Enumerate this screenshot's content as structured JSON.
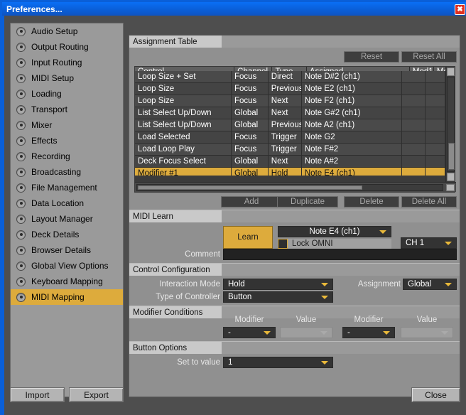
{
  "window": {
    "title": "Preferences...",
    "close_icon": "close-icon",
    "close_glyph": "✖"
  },
  "sidebar": {
    "items": [
      {
        "label": "Audio Setup",
        "selected": false
      },
      {
        "label": "Output Routing",
        "selected": false
      },
      {
        "label": "Input Routing",
        "selected": false
      },
      {
        "label": "MIDI Setup",
        "selected": false
      },
      {
        "label": "Loading",
        "selected": false
      },
      {
        "label": "Transport",
        "selected": false
      },
      {
        "label": "Mixer",
        "selected": false
      },
      {
        "label": "Effects",
        "selected": false
      },
      {
        "label": "Recording",
        "selected": false
      },
      {
        "label": "Broadcasting",
        "selected": false
      },
      {
        "label": "File Management",
        "selected": false
      },
      {
        "label": "Data Location",
        "selected": false
      },
      {
        "label": "Layout Manager",
        "selected": false
      },
      {
        "label": "Deck Details",
        "selected": false
      },
      {
        "label": "Browser Details",
        "selected": false
      },
      {
        "label": "Global View Options",
        "selected": false
      },
      {
        "label": "Keyboard Mapping",
        "selected": false
      },
      {
        "label": "MIDI Mapping",
        "selected": true
      }
    ]
  },
  "assignment_table": {
    "section_title": "Assignment Table",
    "reset_label": "Reset",
    "reset_all_label": "Reset All",
    "columns": [
      "Control",
      "Channel",
      "Type",
      "Assigned",
      "Mod1",
      "Mo"
    ],
    "rows": [
      {
        "control": "Loop Size + Set",
        "channel": "Focus",
        "type": "Direct",
        "assigned": "Note D#2 (ch1)",
        "mod1": "",
        "mod2": "",
        "selected": false
      },
      {
        "control": "Loop Size",
        "channel": "Focus",
        "type": "Previous",
        "assigned": "Note E2 (ch1)",
        "mod1": "",
        "mod2": "",
        "selected": false
      },
      {
        "control": "Loop Size",
        "channel": "Focus",
        "type": "Next",
        "assigned": "Note F2 (ch1)",
        "mod1": "",
        "mod2": "",
        "selected": false
      },
      {
        "control": "List Select Up/Down",
        "channel": "Global",
        "type": "Next",
        "assigned": "Note G#2 (ch1)",
        "mod1": "",
        "mod2": "",
        "selected": false
      },
      {
        "control": "List Select Up/Down",
        "channel": "Global",
        "type": "Previous",
        "assigned": "Note A2 (ch1)",
        "mod1": "",
        "mod2": "",
        "selected": false
      },
      {
        "control": "Load Selected",
        "channel": "Focus",
        "type": "Trigger",
        "assigned": "Note G2",
        "mod1": "",
        "mod2": "",
        "selected": false
      },
      {
        "control": "Load Loop Play",
        "channel": "Focus",
        "type": "Trigger",
        "assigned": "Note F#2",
        "mod1": "",
        "mod2": "",
        "selected": false
      },
      {
        "control": "Deck Focus Select",
        "channel": "Global",
        "type": "Next",
        "assigned": "Note A#2",
        "mod1": "",
        "mod2": "",
        "selected": false
      },
      {
        "control": "Modifier #1",
        "channel": "Global",
        "type": "Hold",
        "assigned": "Note E4 (ch1)",
        "mod1": "",
        "mod2": "",
        "selected": true
      }
    ],
    "add_label": "Add",
    "duplicate_label": "Duplicate",
    "delete_label": "Delete",
    "delete_all_label": "Delete All"
  },
  "midi_learn": {
    "section_title": "MIDI Learn",
    "learn_label": "Learn",
    "note_value": "Note E4 (ch1)",
    "lock_omni_label": "Lock OMNI",
    "lock_omni_checked": false,
    "channel_value": "CH 1",
    "comment_label": "Comment",
    "comment_value": "",
    "comment_placeholder": ""
  },
  "control_configuration": {
    "section_title": "Control Configuration",
    "interaction_mode_label": "Interaction Mode",
    "interaction_mode_value": "Hold",
    "type_of_controller_label": "Type of Controller",
    "type_of_controller_value": "Button",
    "assignment_label": "Assignment",
    "assignment_value": "Global"
  },
  "modifier_conditions": {
    "section_title": "Modifier Conditions",
    "modifier_label_1": "Modifier",
    "value_label_1": "Value",
    "modifier_label_2": "Modifier",
    "value_label_2": "Value",
    "modifier_value_1": "-",
    "cond_value_1": "",
    "modifier_value_2": "-",
    "cond_value_2": ""
  },
  "button_options": {
    "section_title": "Button Options",
    "set_to_value_label": "Set to value",
    "set_to_value": "1"
  },
  "footer": {
    "import_label": "Import",
    "export_label": "Export",
    "close_label": "Close"
  },
  "colors": {
    "accent": "#ddab3c",
    "titlebar": "#0a5fd8",
    "panel_bg": "#909090",
    "sidebar_bg": "#9a9a9a",
    "table_bg": "#4a4a4a",
    "dropdown_bg": "#333333"
  }
}
